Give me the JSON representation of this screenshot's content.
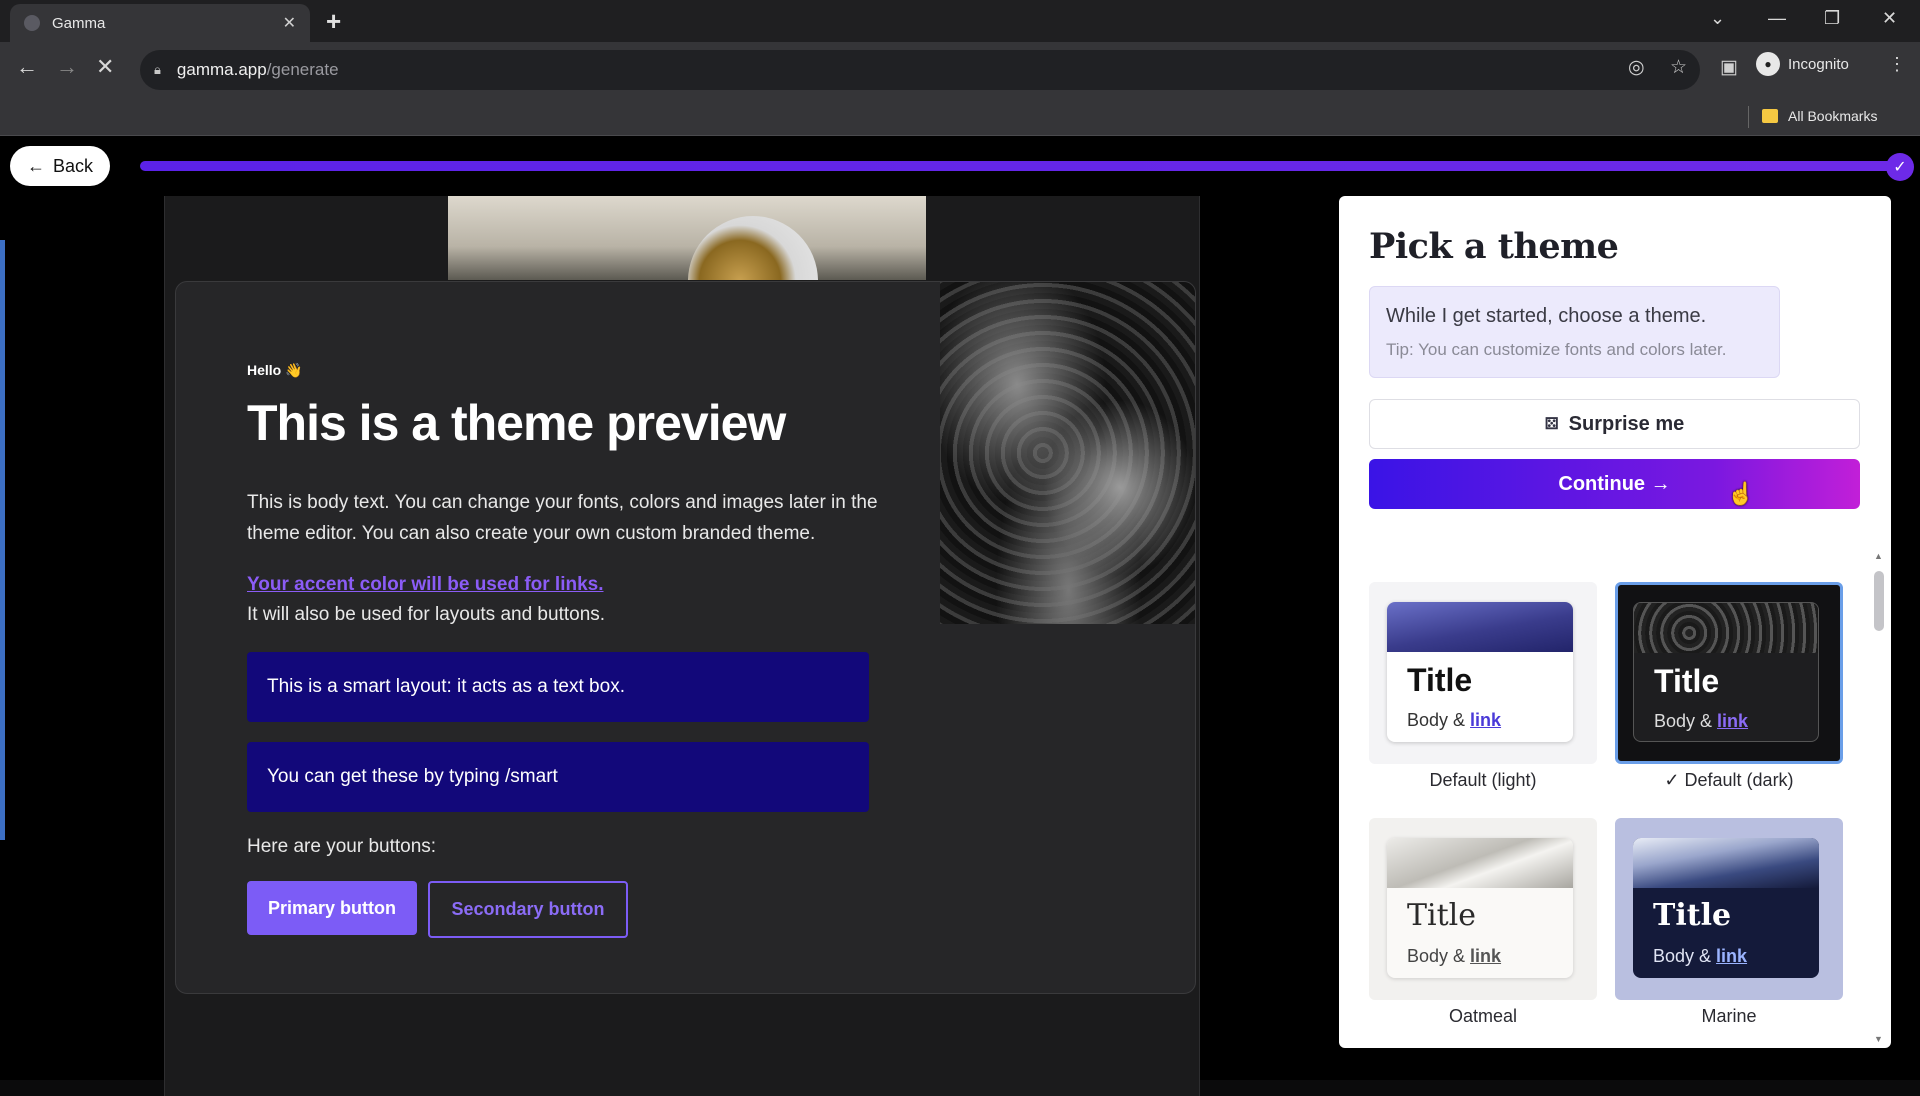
{
  "browser": {
    "tab_title": "Gamma",
    "tab_close": "✕",
    "new_tab": "+",
    "url_host": "gamma.app",
    "url_path": "/generate",
    "profile": "Incognito",
    "bookmarks_label": "All Bookmarks"
  },
  "app": {
    "back_label": "Back",
    "progress": 1.0
  },
  "preview": {
    "hello": "Hello 👋",
    "heading": "This is a theme preview",
    "body": "This is body text. You can change your fonts, colors and images later in the theme editor. You can also create your own custom branded theme.",
    "accent_link": "Your accent color will be used for links.",
    "accent_note": "It will also be used for layouts and buttons.",
    "smart_1": "This is a smart layout: it acts as a text box.",
    "smart_2": "You can get these by typing /smart",
    "buttons_intro": "Here are your buttons:",
    "primary_button": "Primary button",
    "secondary_button": "Secondary button"
  },
  "panel": {
    "title": "Pick a theme",
    "tip_line1": "While I get started, choose a theme.",
    "tip_line2": "Tip: You can customize fonts and colors later.",
    "surprise_label": "Surprise me",
    "continue_label": "Continue →",
    "themes": [
      {
        "name": "Default (light)",
        "title": "Title",
        "body": "Body & ",
        "link": "link",
        "selected": false
      },
      {
        "name": "Default (dark)",
        "title": "Title",
        "body": "Body & ",
        "link": "link",
        "selected": true
      },
      {
        "name": "Oatmeal",
        "title": "Title",
        "body": "Body & ",
        "link": "link",
        "selected": false
      },
      {
        "name": "Marine",
        "title": "Title",
        "body": "Body & ",
        "link": "link",
        "selected": false
      }
    ]
  },
  "colors": {
    "accent": "#7c5cf6",
    "smart_layout_bg": "#12087a",
    "continue_gradient_start": "#3a14e6",
    "continue_gradient_end": "#c21fd8"
  }
}
